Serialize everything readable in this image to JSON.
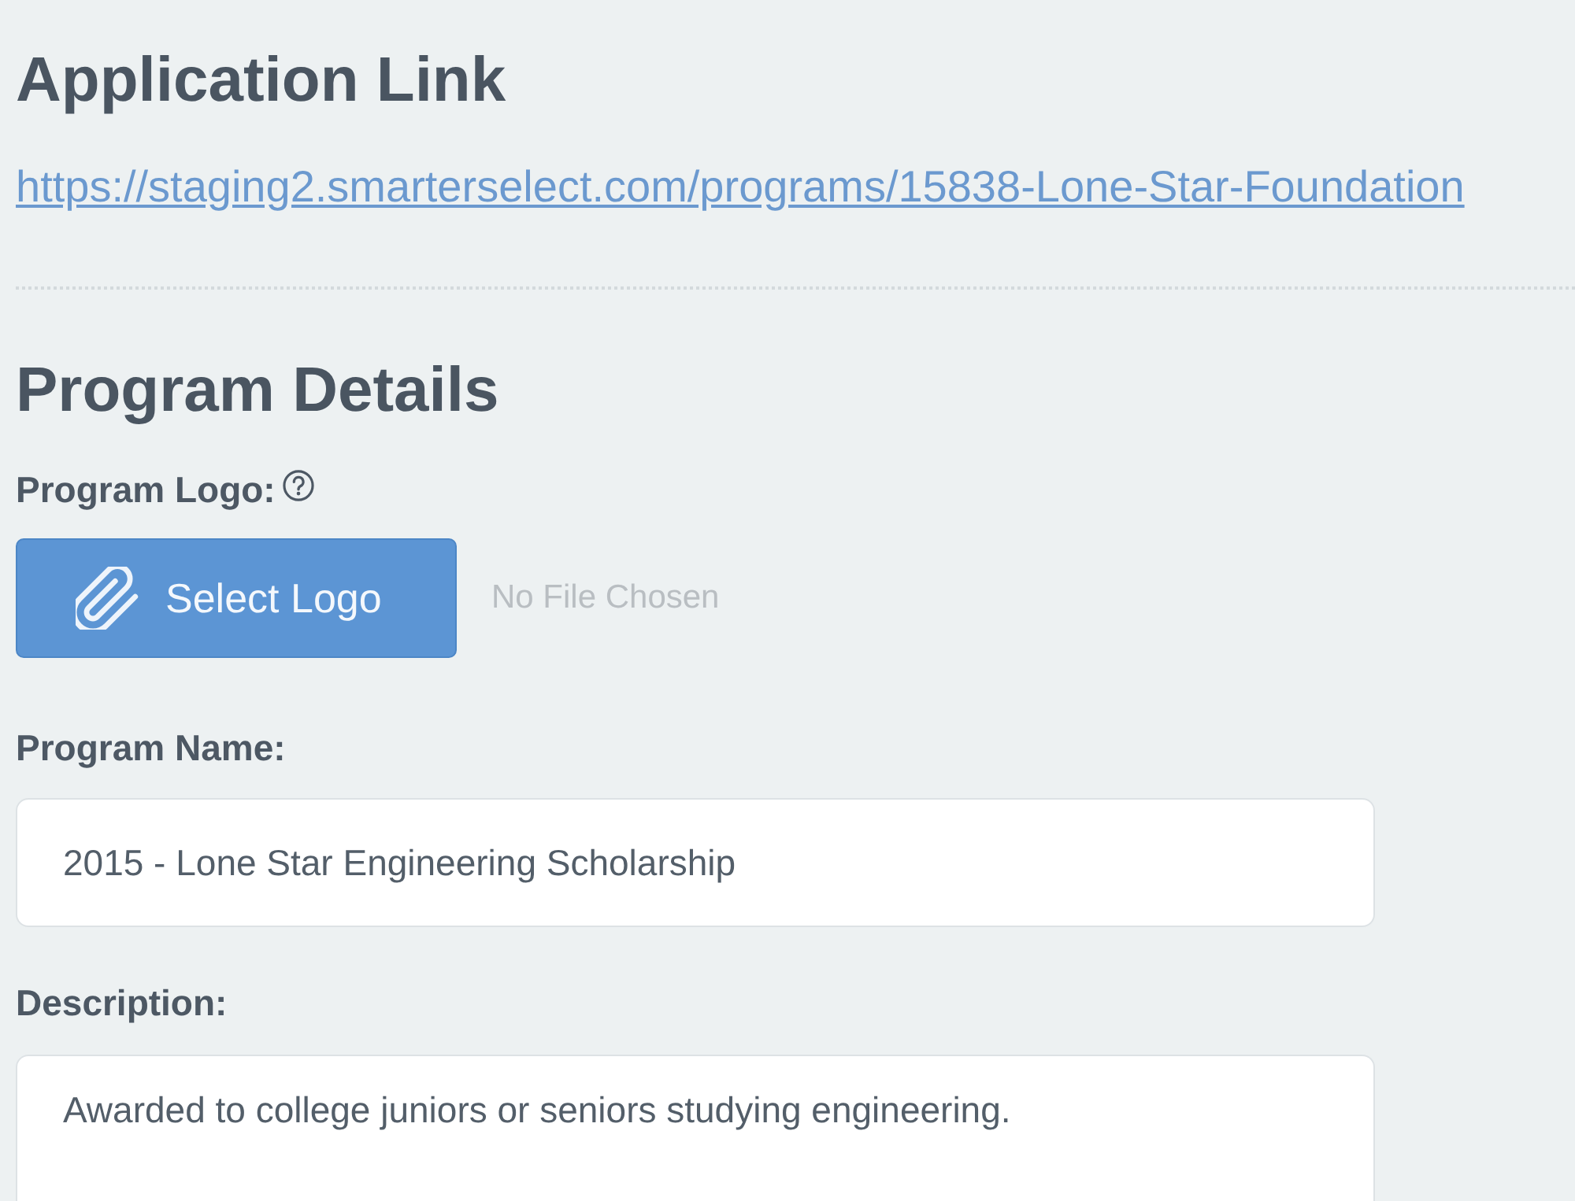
{
  "application_link": {
    "heading": "Application Link",
    "url": "https://staging2.smarterselect.com/programs/15838-Lone-Star-Foundation"
  },
  "program_details": {
    "heading": "Program Details",
    "fields": [
      {
        "kind": "file",
        "label": "Program Logo:",
        "help": true,
        "button": "Select Logo",
        "status": "No File Chosen"
      },
      {
        "kind": "text",
        "label": "Program Name:",
        "value": "2015 - Lone Star Engineering Scholarship"
      },
      {
        "kind": "textarea",
        "label": "Description:",
        "value": "Awarded to college juniors or seniors studying engineering."
      }
    ]
  }
}
